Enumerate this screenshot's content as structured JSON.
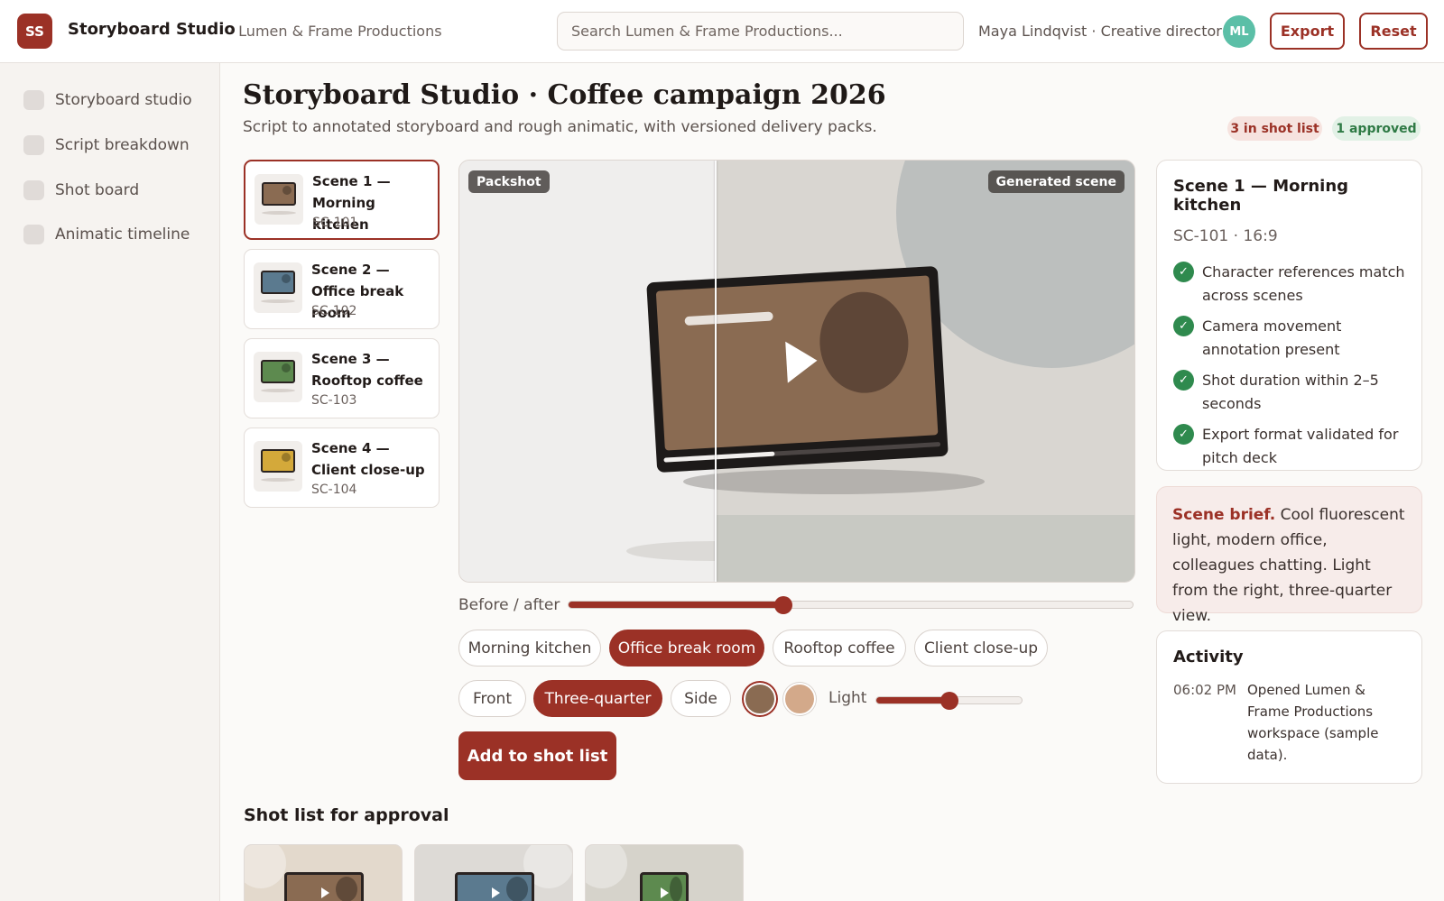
{
  "app": {
    "logo_initials": "SS",
    "name": "Storyboard Studio",
    "workspace": "· Lumen & Frame Productions"
  },
  "search": {
    "placeholder": "Search Lumen & Frame Productions..."
  },
  "user": {
    "line": "Maya Lindqvist · Creative director",
    "initials": "ML",
    "avatar_color": "#5bbfa7"
  },
  "toolbar": {
    "export_label": "Export",
    "reset_label": "Reset"
  },
  "sidebar": {
    "items": [
      {
        "label": "Storyboard studio",
        "active": true
      },
      {
        "label": "Script breakdown",
        "active": false
      },
      {
        "label": "Shot board",
        "active": false
      },
      {
        "label": "Animatic timeline",
        "active": false
      }
    ]
  },
  "header": {
    "title": "Storyboard Studio · Coffee campaign 2026",
    "subtitle": "Script to annotated storyboard and rough animatic, with versioned delivery packs.",
    "badges": {
      "shot_list": "3 in shot list",
      "approved": "1 approved"
    }
  },
  "scenes": [
    {
      "name": "Scene 1 — Morning kitchen",
      "code": "SC-101",
      "color": "#8a6b52",
      "selected": true
    },
    {
      "name": "Scene 2 — Office break room",
      "code": "SC-102",
      "color": "#5b7a8f",
      "selected": false
    },
    {
      "name": "Scene 3 — Rooftop coffee",
      "code": "SC-103",
      "color": "#5d8a4f",
      "selected": false
    },
    {
      "name": "Scene 4 — Client close-up",
      "code": "SC-104",
      "color": "#d4a93a",
      "selected": false
    }
  ],
  "viewer": {
    "left_tag": "Packshot",
    "right_tag": "Generated scene",
    "split": 0.38,
    "playback_progress": 0.4
  },
  "before_after": {
    "label": "Before / after",
    "value": 0.38
  },
  "scene_chips": [
    {
      "label": "Morning kitchen",
      "active": false
    },
    {
      "label": "Office break room",
      "active": true
    },
    {
      "label": "Rooftop coffee",
      "active": false
    },
    {
      "label": "Client close-up",
      "active": false
    }
  ],
  "angle_chips": [
    {
      "label": "Front",
      "active": false
    },
    {
      "label": "Three-quarter",
      "active": true
    },
    {
      "label": "Side",
      "active": false
    }
  ],
  "swatches": [
    {
      "color": "#8a6b52",
      "selected": true
    },
    {
      "color": "#d3a98a",
      "selected": false
    }
  ],
  "light": {
    "label": "Light",
    "value": 0.5
  },
  "add_button": "Add to shot list",
  "shot_list": {
    "title": "Shot list for approval",
    "items": [
      {
        "bg": "#e3d9cc",
        "color": "#8a6b52"
      },
      {
        "bg": "#dddad6",
        "color": "#5b7a8f"
      },
      {
        "bg": "#d6d3cb",
        "color": "#5d8a4f"
      }
    ]
  },
  "checks": {
    "title": "Scene 1 — Morning kitchen",
    "meta": "SC-101 · 16:9",
    "items": [
      "Character references match across scenes",
      "Camera movement annotation present",
      "Shot duration within 2–5 seconds",
      "Export format validated for pitch deck"
    ]
  },
  "brief": {
    "lead": "Scene brief.",
    "text": " Cool fluorescent light, modern office, colleagues chatting. Light from the right, three-quarter view."
  },
  "activity": {
    "title": "Activity",
    "entries": [
      {
        "time": "06:02 PM",
        "text": "Opened Lumen & Frame Productions workspace (sample data)."
      }
    ]
  },
  "colors": {
    "accent": "#9b3126",
    "success": "#2f8a4e"
  }
}
